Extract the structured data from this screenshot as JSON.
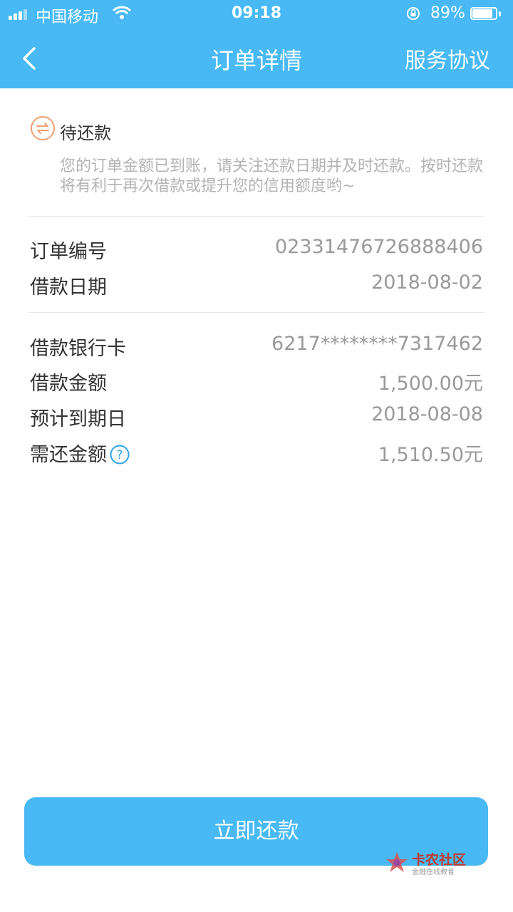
{
  "status_bar": {
    "carrier": "中国移动",
    "time": "09:18",
    "battery_percent": "89%",
    "battery_level": 0.89,
    "icons": [
      "signal-icon",
      "wifi-icon",
      "orientation-lock-icon",
      "battery-icon"
    ]
  },
  "nav": {
    "title": "订单详情",
    "right_link": "服务协议",
    "back_icon": "chevron-left-icon"
  },
  "order_status": {
    "label": "待还款",
    "icon": "repay-exchange-icon",
    "description": "您的订单金额已到账，请关注还款日期并及时还款。按时还款将有利于再次借款或提升您的信用额度哟~"
  },
  "details_1": [
    {
      "label": "订单编号",
      "value": "02331476726888406"
    },
    {
      "label": "借款日期",
      "value": "2018-08-02"
    }
  ],
  "details_2": [
    {
      "label": "借款银行卡",
      "value": "6217********7317462"
    },
    {
      "label": "借款金额",
      "value": "1,500.00元"
    },
    {
      "label": "预计到期日",
      "value": "2018-08-08"
    },
    {
      "label": "需还金额",
      "value": "1,510.50元"
    }
  ],
  "help_icon": "question-circle-icon",
  "pay_button": "立即还款",
  "watermark": {
    "title": "卡农社区",
    "subtitle": "金融在线教育"
  },
  "colors": {
    "primary": "#48b9f4",
    "status_icon": "#f0a070",
    "text_muted": "#999999"
  }
}
